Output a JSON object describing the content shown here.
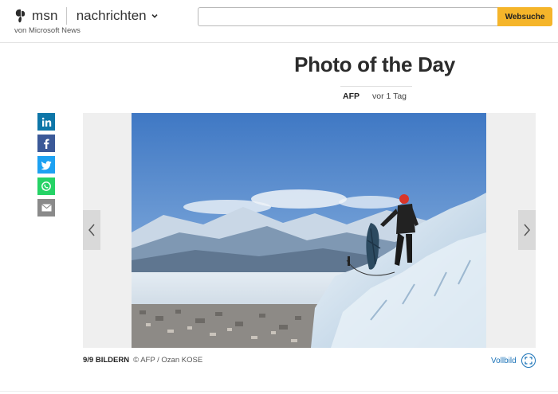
{
  "header": {
    "brand": "msn",
    "section": "nachrichten",
    "subbrand": "von Microsoft News",
    "search": {
      "value": "",
      "placeholder": "",
      "button_label": "Websuche"
    }
  },
  "article": {
    "title": "Photo of the Day",
    "source": "AFP",
    "time": "vor 1 Tag"
  },
  "share": {
    "icons": [
      "linkedin-icon",
      "facebook-icon",
      "twitter-icon",
      "whatsapp-icon",
      "email-icon"
    ],
    "colors": {
      "linkedin": "#0e76a8",
      "facebook": "#3b5998",
      "twitter": "#1da1f2",
      "whatsapp": "#25d366",
      "email": "#8a8a8a"
    }
  },
  "slideshow": {
    "counter": "9/9 BILDERN",
    "credit": "© AFP / Ozan KOSE",
    "fullscreen_label": "Vollbild"
  },
  "colors": {
    "accent": "#f5b52a",
    "link": "#1b73b8"
  }
}
